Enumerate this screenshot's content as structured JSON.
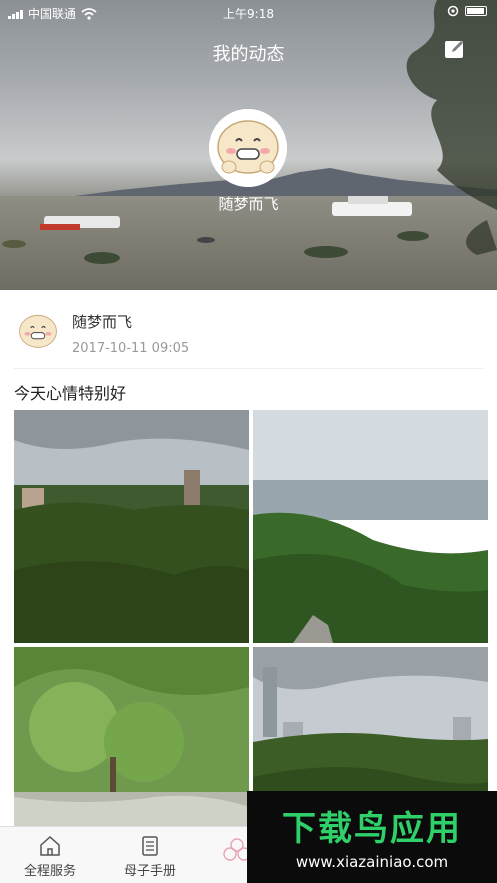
{
  "status_bar": {
    "carrier": "中国联通",
    "time": "上午9:18"
  },
  "header": {
    "title": "我的动态",
    "edit_icon": "edit-icon",
    "user_name": "随梦而飞"
  },
  "post": {
    "author": "随梦而飞",
    "timestamp": "2017-10-11 09:05",
    "text": "今天心情特别好",
    "photos": [
      "photo-hill-forest",
      "photo-city-valley",
      "photo-garden-tree",
      "photo-city-skyline"
    ]
  },
  "tabbar": {
    "items": [
      {
        "label": "全程服务",
        "icon": "home-icon"
      },
      {
        "label": "母子手册",
        "icon": "handbook-icon"
      }
    ]
  },
  "watermark": {
    "title": "下载鸟应用",
    "url": "www.xiazainiao.com"
  }
}
